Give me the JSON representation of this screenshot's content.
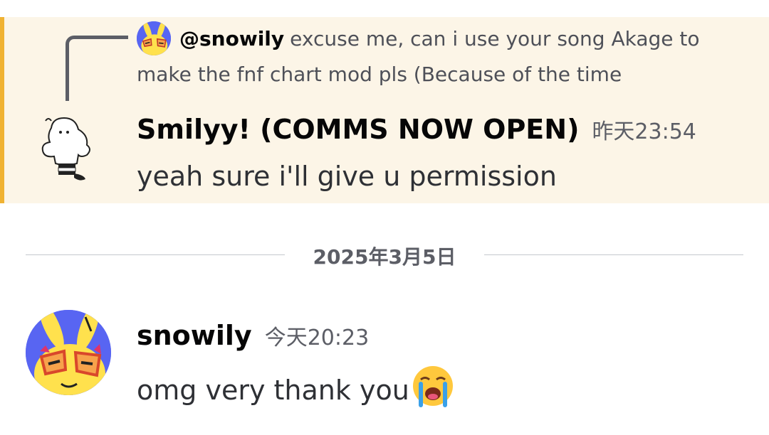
{
  "reply": {
    "author": "@snowily",
    "text": "excuse me, can i use your song Akage to make the fnf chart mod pls (Because of the time"
  },
  "highlighted_message": {
    "author": "Smilyy! (COMMS NOW OPEN)",
    "timestamp": "昨天23:54",
    "text": "yeah sure i'll give u permission",
    "avatar_icon": "ghost-avatar"
  },
  "date_divider": {
    "label": "2025年3月5日"
  },
  "latest_message": {
    "author": "snowily",
    "timestamp": "今天20:23",
    "text": "omg very thank you",
    "emoji": "loudly-crying-face-emoji",
    "avatar_icon": "yellow-bunny-avatar"
  },
  "colors": {
    "highlight_background": "#fcf5e7",
    "highlight_bar": "#f0b232",
    "avatar_background": "#5865f2",
    "muted_text": "#5c5e66"
  }
}
